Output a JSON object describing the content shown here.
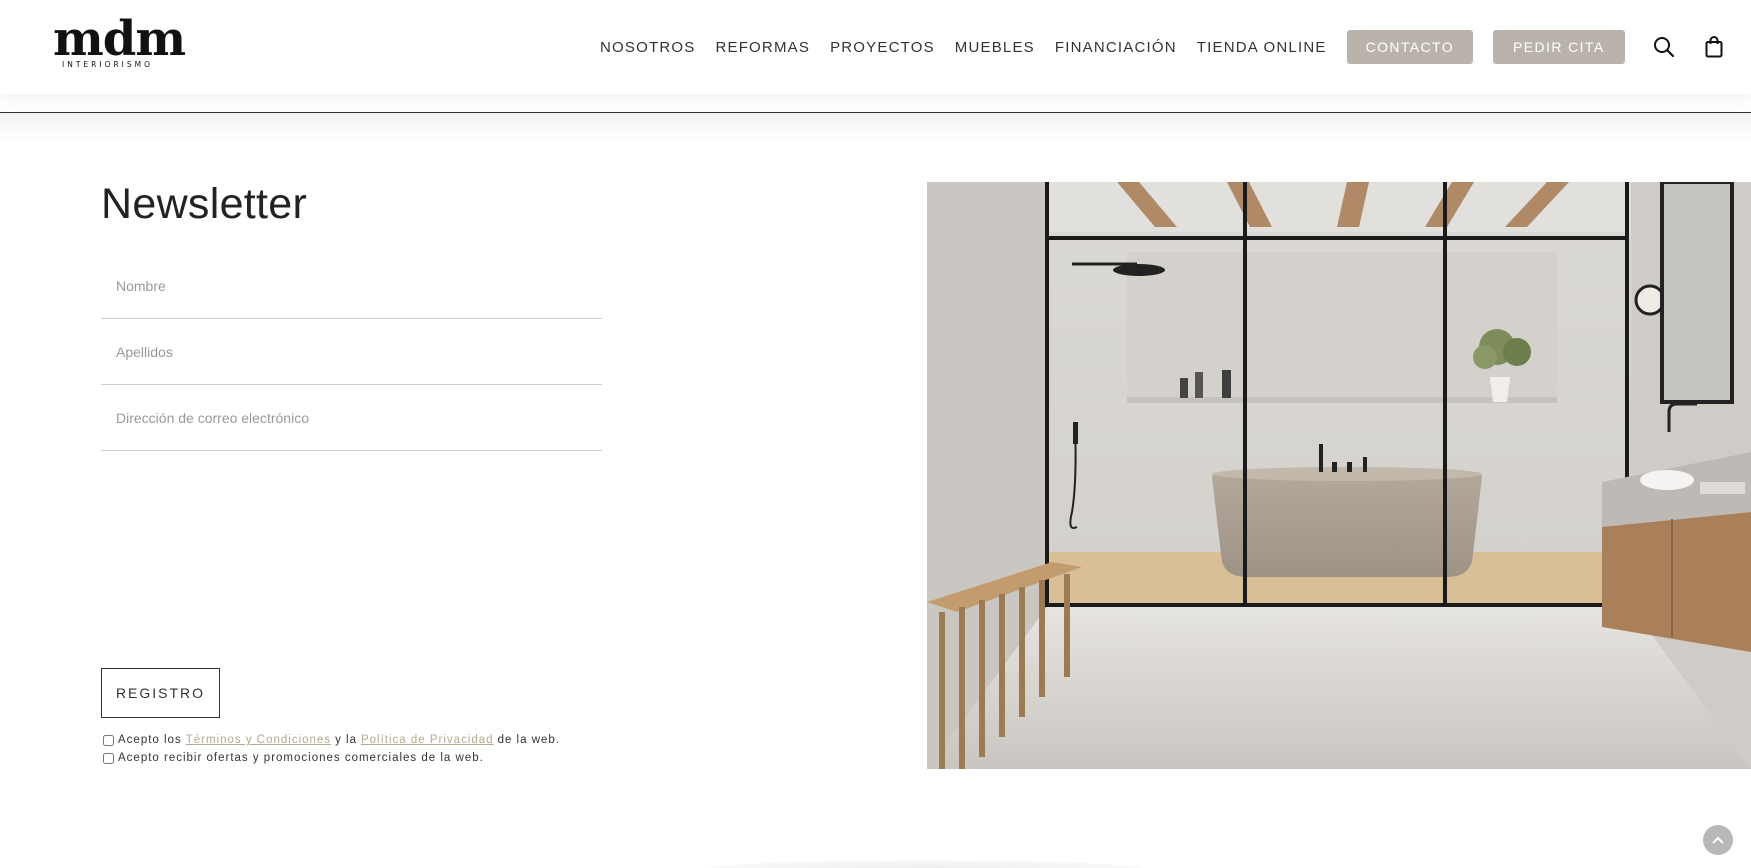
{
  "logo": {
    "main": "mdm",
    "sub": "INTERIORISMO"
  },
  "nav": {
    "links": [
      "NOSOTROS",
      "REFORMAS",
      "PROYECTOS",
      "MUEBLES",
      "FINANCIACIÓN",
      "TIENDA ONLINE"
    ],
    "contact_label": "CONTACTO",
    "appointment_label": "PEDIR CITA",
    "button_color": "#b9b3ac"
  },
  "icons": {
    "search": "search-icon",
    "cart": "shopping-bag-icon",
    "scroll_top": "chevron-up-icon"
  },
  "newsletter": {
    "title": "Newsletter",
    "fields": {
      "first_name": "Nombre",
      "last_name": "Apellidos",
      "email": "Dirección de correo electrónico"
    },
    "submit_label": "REGISTRO",
    "terms": {
      "prefix": "Acepto los",
      "terms_link": "Términos y Condiciones",
      "middle": "y la",
      "privacy_link": "Política de Privacidad",
      "suffix": "de la web."
    },
    "offers_label": "Acepto recibir ofertas y promociones comerciales de la web.",
    "link_color": "#b5a98f"
  },
  "image": {
    "alt_subject": "bathroom-interior"
  }
}
